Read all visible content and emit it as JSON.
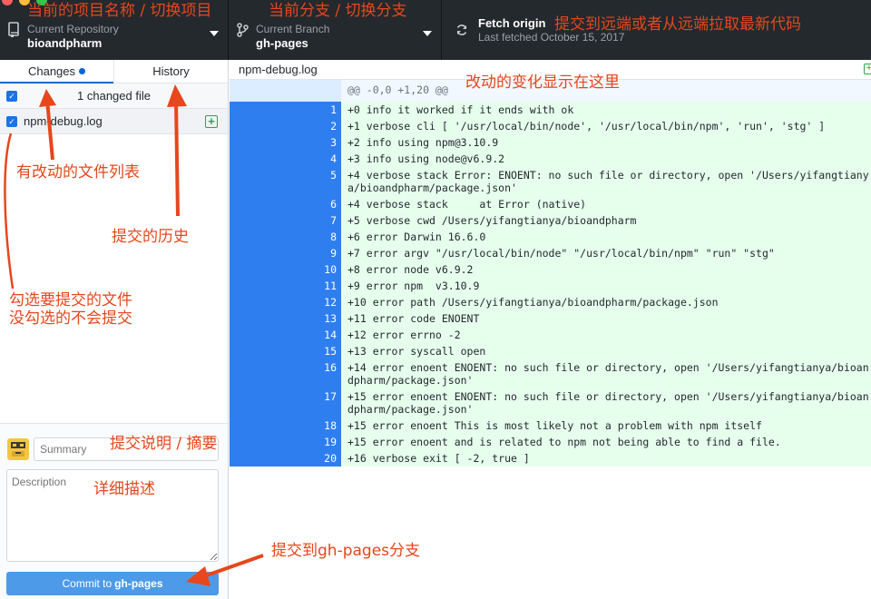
{
  "toolbar": {
    "repo": {
      "label": "Current Repository",
      "value": "bioandpharm"
    },
    "branch": {
      "label": "Current Branch",
      "value": "gh-pages"
    },
    "fetch": {
      "label": "Fetch origin",
      "sub": "Last fetched October 15, 2017"
    }
  },
  "tabs": {
    "changes": "Changes",
    "history": "History"
  },
  "changes": {
    "header": "1 changed file",
    "files": [
      {
        "name": "npm-debug.log"
      }
    ]
  },
  "commit": {
    "summary_placeholder": "Summary",
    "description_placeholder": "Description",
    "button_prefix": "Commit to",
    "button_branch": "gh-pages"
  },
  "diff": {
    "filename": "npm-debug.log",
    "hunk": "@@ -0,0 +1,20 @@",
    "lines": [
      {
        "n": "1",
        "text": "+0 info it worked if it ends with ok"
      },
      {
        "n": "2",
        "text": "+1 verbose cli [ '/usr/local/bin/node', '/usr/local/bin/npm', 'run', 'stg' ]"
      },
      {
        "n": "3",
        "text": "+2 info using npm@3.10.9"
      },
      {
        "n": "4",
        "text": "+3 info using node@v6.9.2"
      },
      {
        "n": "5",
        "text": "+4 verbose stack Error: ENOENT: no such file or directory, open '/Users/yifangtianya/bioandpharm/package.json'"
      },
      {
        "n": "6",
        "text": "+4 verbose stack     at Error (native)"
      },
      {
        "n": "7",
        "text": "+5 verbose cwd /Users/yifangtianya/bioandpharm"
      },
      {
        "n": "8",
        "text": "+6 error Darwin 16.6.0"
      },
      {
        "n": "9",
        "text": "+7 error argv \"/usr/local/bin/node\" \"/usr/local/bin/npm\" \"run\" \"stg\""
      },
      {
        "n": "10",
        "text": "+8 error node v6.9.2"
      },
      {
        "n": "11",
        "text": "+9 error npm  v3.10.9"
      },
      {
        "n": "12",
        "text": "+10 error path /Users/yifangtianya/bioandpharm/package.json"
      },
      {
        "n": "13",
        "text": "+11 error code ENOENT"
      },
      {
        "n": "14",
        "text": "+12 error errno -2"
      },
      {
        "n": "15",
        "text": "+13 error syscall open"
      },
      {
        "n": "16",
        "text": "+14 error enoent ENOENT: no such file or directory, open '/Users/yifangtianya/bioandpharm/package.json'"
      },
      {
        "n": "17",
        "text": "+15 error enoent ENOENT: no such file or directory, open '/Users/yifangtianya/bioandpharm/package.json'"
      },
      {
        "n": "18",
        "text": "+15 error enoent This is most likely not a problem with npm itself"
      },
      {
        "n": "19",
        "text": "+15 error enoent and is related to npm not being able to find a file."
      },
      {
        "n": "20",
        "text": "+16 verbose exit [ -2, true ]"
      }
    ]
  },
  "annotations": {
    "repo": "当前的项目名称 / 切换项目",
    "branch": "当前分支 / 切换分支",
    "fetch": "提交到远端或者从远端拉取最新代码",
    "diff": "改动的变化显示在这里",
    "file_list": "有改动的文件列表",
    "history": "提交的历史",
    "check_line1": "勾选要提交的文件",
    "check_line2": "没勾选的不会提交",
    "summary": "提交说明 / 摘要",
    "description": "详细描述",
    "commit_branch": "提交到gh-pages分支"
  },
  "colors": {
    "accent": "#0366d6",
    "annotation": "#e8461c",
    "toolbar": "#24292e",
    "gutter": "#2f7ef0",
    "added": "#e6ffed"
  }
}
